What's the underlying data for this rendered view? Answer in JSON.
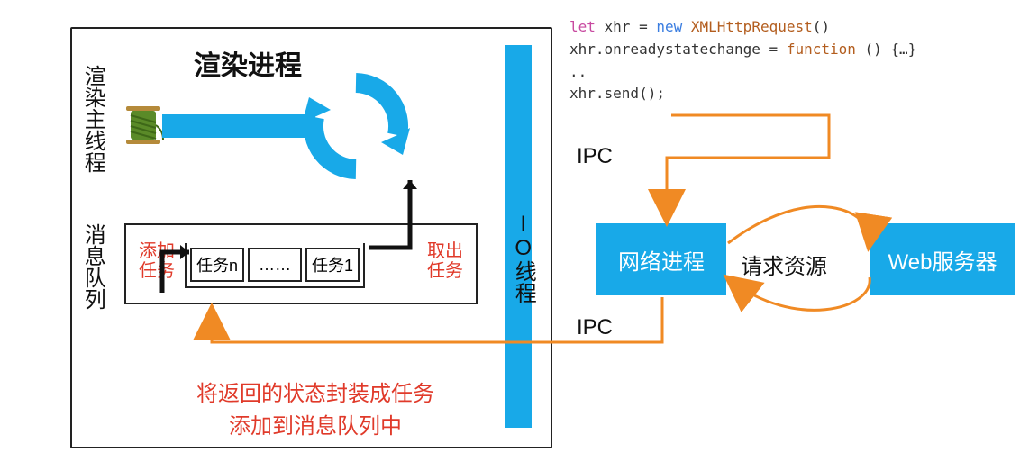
{
  "labels": {
    "render_process": "渲染进程",
    "render_main_thread": "渲染主线程",
    "message_queue": "消息队列",
    "io_thread": "IO线程",
    "add_task": "添加任务",
    "pop_task": "取出任务",
    "footer_line1": "将返回的状态封装成任务",
    "footer_line2": "添加到消息队列中",
    "ipc": "IPC",
    "network_process": "网络进程",
    "request_resource": "请求资源",
    "web_server": "Web服务器"
  },
  "queue": {
    "cells": [
      "任务n",
      "……",
      "任务1"
    ]
  },
  "code": {
    "let": "let",
    "xhrvar": " xhr = ",
    "newkw": "new",
    "ctor": " XMLHttpRequest",
    "paren": "()",
    "l2a": "xhr.onreadystatechange = ",
    "l2fn": "function",
    "l2b": " () {…}",
    "l3": "..",
    "l4": "xhr.send();"
  }
}
